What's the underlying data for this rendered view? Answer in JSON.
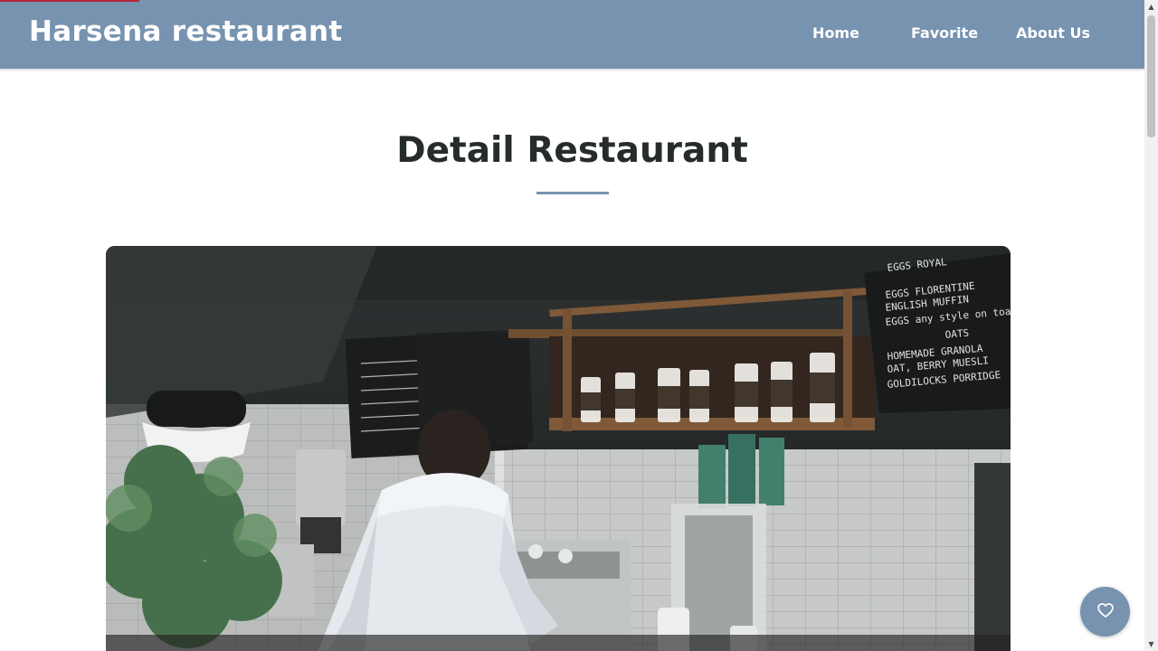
{
  "progress": {
    "fraction": 0.12,
    "color": "#b5283a"
  },
  "header": {
    "brand": "Harsena restaurant",
    "background": "#7793b0",
    "nav": [
      {
        "label": "Home"
      },
      {
        "label": "Favorite"
      },
      {
        "label": "About Us"
      }
    ]
  },
  "main": {
    "title": "Detail Restaurant",
    "title_color": "#262b2b",
    "accent": "#7793b0",
    "hero_image": {
      "alt": "restaurant photo",
      "chalkboard_lines": [
        "EGGS ROYAL",
        "EGGS FLORENTINE",
        "ENGLISH MUFFIN",
        "EGGS any style on toast",
        "OATS",
        "HOMEMADE GRANOLA",
        "OAT, BERRY MUESLI",
        "GOLDILOCKS PORRIDGE"
      ]
    }
  },
  "favorite_button": {
    "icon": "heart-icon",
    "label": "Add to favorite"
  }
}
